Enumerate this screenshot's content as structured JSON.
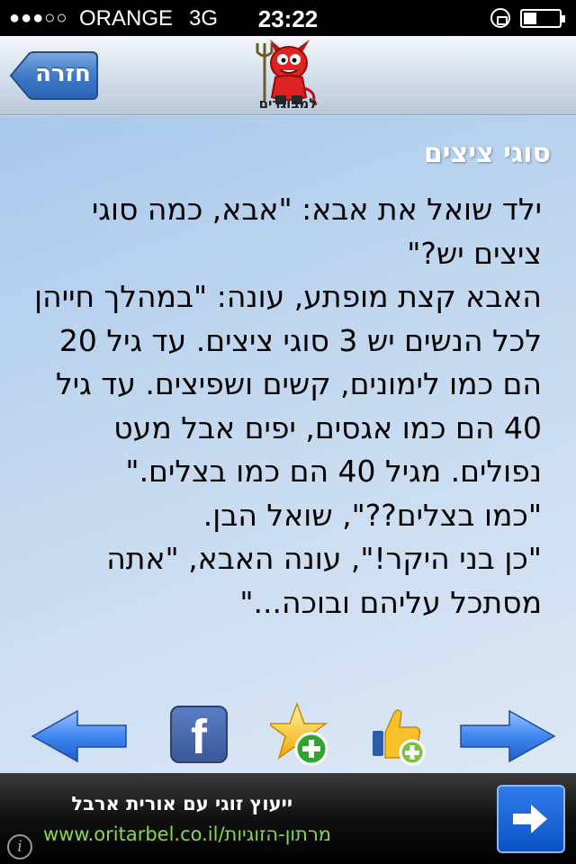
{
  "status_bar": {
    "signal": "●●●○○",
    "carrier": "ORANGE",
    "network": "3G",
    "time": "23:22",
    "icons": [
      "rotation-lock-icon",
      "battery-icon"
    ]
  },
  "nav": {
    "back_label": "חזרה",
    "logo_text": "למבוגרים",
    "logo_icon": "devil-mascot-icon"
  },
  "joke": {
    "title": "סוגי ציצים",
    "paragraphs": [
      "ילד שואל את אבא: \"אבא, כמה סוגי ציצים יש?\"",
      "האבא קצת מופתע, עונה: \"במהלך חייהן לכל הנשים יש 3 סוגי ציצים. עד גיל 20 הם כמו לימונים, קשים ושפיצים. עד גיל 40 הם כמו אגסים, יפים אבל מעט נפולים. מגיל 40 הם כמו בצלים.\"",
      "\"כמו בצלים??\", שואל הבן.",
      "\"כן בני היקר!\", עונה האבא, \"אתה מסתכל עליהם ובוכה...\""
    ]
  },
  "actions": {
    "facebook_letter": "f",
    "icons": [
      "previous-arrow-icon",
      "facebook-icon",
      "add-favorite-star-icon",
      "like-thumb-icon",
      "next-arrow-icon"
    ]
  },
  "ad": {
    "title": "ייעוץ זוגי עם אורית ארבל",
    "url": "www.oritarbel.co.il/מרתון-הזוגיות",
    "info": "i"
  },
  "colors": {
    "accent_blue": "#2f7be8",
    "nav_button": "#3d79c6",
    "ad_link": "#8ad84a"
  }
}
